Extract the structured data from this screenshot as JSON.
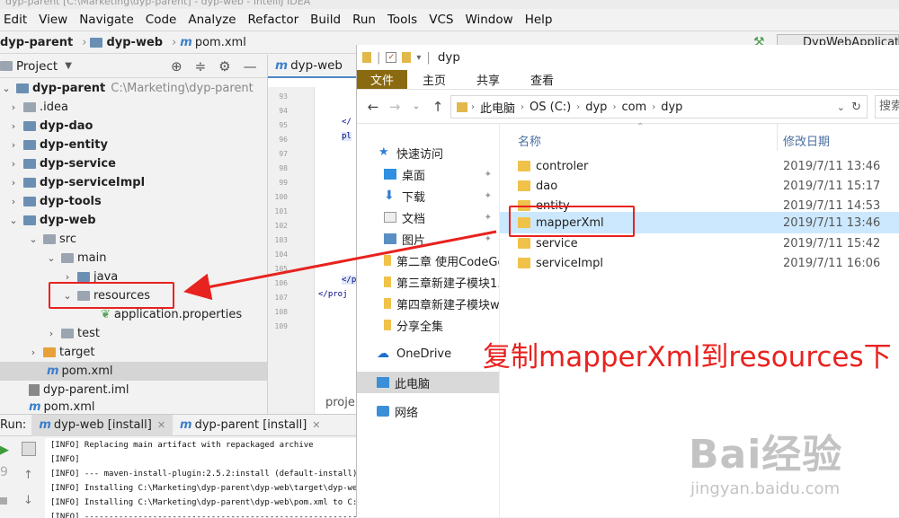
{
  "ide": {
    "title": "dyp-parent [C:\\Marketing\\dyp-parent] - dyp-web - IntelliJ IDEA",
    "menu": [
      "Edit",
      "View",
      "Navigate",
      "Code",
      "Analyze",
      "Refactor",
      "Build",
      "Run",
      "Tools",
      "VCS",
      "Window",
      "Help"
    ],
    "breadcrumb": [
      "dyp-parent",
      "dyp-web",
      "pom.xml"
    ],
    "run_config": "DypWebApplication",
    "project_label": "Project",
    "tree": [
      {
        "label": "dyp-parent",
        "extra": "C:\\Marketing\\dyp-parent",
        "bold": true
      },
      {
        "label": ".idea"
      },
      {
        "label": "dyp-dao",
        "bold": true
      },
      {
        "label": "dyp-entity",
        "bold": true
      },
      {
        "label": "dyp-service",
        "bold": true
      },
      {
        "label": "dyp-serviceImpl",
        "bold": true
      },
      {
        "label": "dyp-tools",
        "bold": true
      },
      {
        "label": "dyp-web",
        "bold": true
      },
      {
        "label": "src"
      },
      {
        "label": "main"
      },
      {
        "label": "java"
      },
      {
        "label": "resources"
      },
      {
        "label": "application.properties"
      },
      {
        "label": "test"
      },
      {
        "label": "target"
      },
      {
        "label": "pom.xml"
      },
      {
        "label": "dyp-parent.iml"
      },
      {
        "label": "pom.xml"
      }
    ],
    "editor_tab": "dyp-web",
    "line_numbers": [
      "93",
      "94",
      "95",
      "96",
      "97",
      "98",
      "99",
      "100",
      "101",
      "102",
      "103",
      "104",
      "105",
      "106",
      "107",
      "108",
      "109"
    ],
    "code_fragments": [
      "</",
      "pl",
      "</p",
      "</proj"
    ],
    "proje_label": "proje",
    "run": {
      "label": "Run:",
      "tabs": [
        "dyp-web [install]",
        "dyp-parent [install]"
      ],
      "console": [
        "[INFO] Replacing main artifact with repackaged archive",
        "[INFO]",
        "[INFO] --- maven-install-plugin:2.5.2:install (default-install)",
        "[INFO] Installing C:\\Marketing\\dyp-parent\\dyp-web\\target\\dyp-we",
        "[INFO] Installing C:\\Marketing\\dyp-parent\\dyp-web\\pom.xml to C:",
        "[INFO] ------------------------------------------------------------"
      ]
    }
  },
  "explorer": {
    "title": "dyp",
    "ribbon_tabs": [
      "文件",
      "主页",
      "共享",
      "查看"
    ],
    "address": [
      "此电脑",
      "OS (C:)",
      "dyp",
      "com",
      "dyp"
    ],
    "search_placeholder": "搜索",
    "nav": [
      {
        "label": "快速访问"
      },
      {
        "label": "桌面",
        "pinned": true
      },
      {
        "label": "下载",
        "pinned": true
      },
      {
        "label": "文档",
        "pinned": true
      },
      {
        "label": "图片",
        "pinned": true
      },
      {
        "label": "第二章 使用CodeGe"
      },
      {
        "label": "第三章新建子模块1."
      },
      {
        "label": "第四章新建子模块w"
      },
      {
        "label": "分享全集"
      },
      {
        "label": "OneDrive"
      },
      {
        "label": "此电脑"
      },
      {
        "label": "网络"
      }
    ],
    "columns": {
      "name": "名称",
      "date": "修改日期"
    },
    "files": [
      {
        "name": "controler",
        "date": "2019/7/11 13:46"
      },
      {
        "name": "dao",
        "date": "2019/7/11 15:17"
      },
      {
        "name": "entity",
        "date": "2019/7/11 14:53"
      },
      {
        "name": "mapperXml",
        "date": "2019/7/11 13:46",
        "selected": true
      },
      {
        "name": "service",
        "date": "2019/7/11 15:42"
      },
      {
        "name": "serviceImpl",
        "date": "2019/7/11 16:06"
      }
    ]
  },
  "annotation": "复制mapperXml到resources下",
  "watermark": {
    "brand": "Bai经验",
    "url": "jingyan.baidu.com"
  },
  "colors": {
    "annotation_red": "#e8221f",
    "selection_blue": "#cce8ff",
    "file_tab": "#8a6a10",
    "folder_yellow": "#f0c24a"
  }
}
